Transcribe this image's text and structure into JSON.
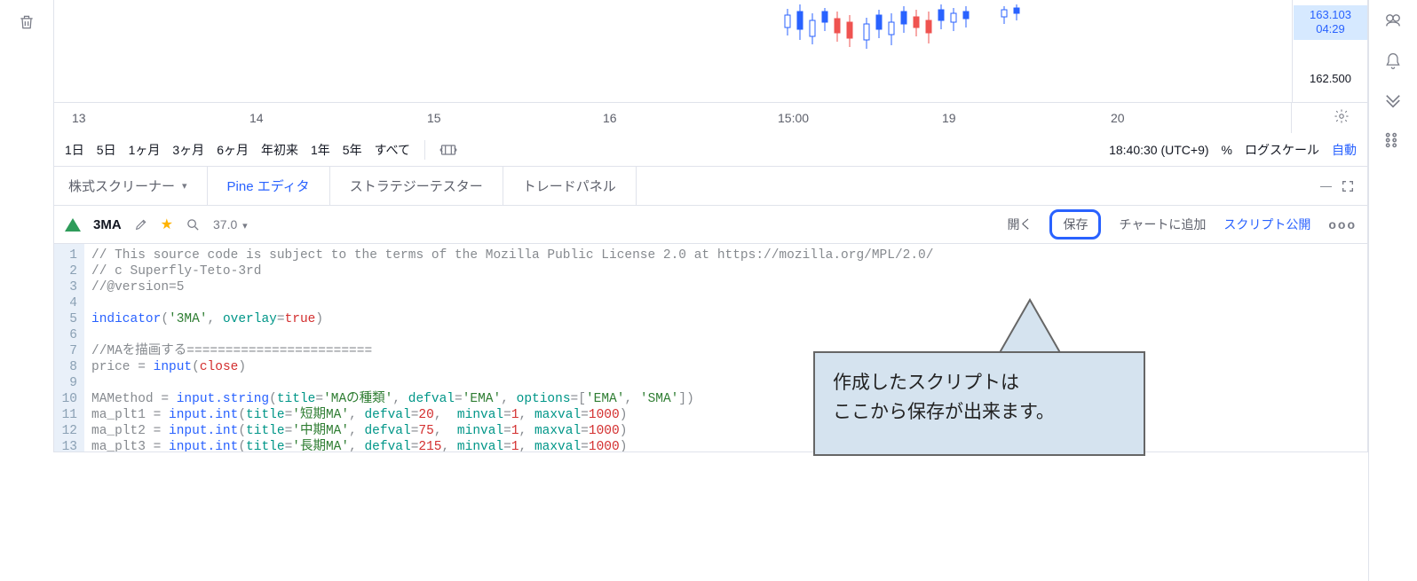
{
  "price": {
    "current": "163.103",
    "time": "04:29",
    "level": "162.500"
  },
  "xaxis_ticks": [
    "13",
    "14",
    "15",
    "16",
    "15:00",
    "19",
    "20"
  ],
  "timeframes": [
    "1日",
    "5日",
    "1ヶ月",
    "3ヶ月",
    "6ヶ月",
    "年初来",
    "1年",
    "5年",
    "すべて"
  ],
  "clock": "18:40:30 (UTC+9)",
  "percent": "%",
  "logscale": "ログスケール",
  "auto": "自動",
  "panel_tabs": {
    "screener": "株式スクリーナー",
    "pine": "Pine エディタ",
    "tester": "ストラテジーテスター",
    "panel": "トレードパネル"
  },
  "script": {
    "name": "3MA",
    "version": "37.0",
    "open": "開く",
    "save": "保存",
    "add": "チャートに追加",
    "publish": "スクリプト公開",
    "more": "ooo"
  },
  "code_lines": [
    {
      "n": 1,
      "html": "// This source code is subject to the terms of the Mozilla Public License 2.0 at https://mozilla.org/MPL/2.0/"
    },
    {
      "n": 2,
      "html": "// c Superfly-Teto-3rd"
    },
    {
      "n": 3,
      "html": "//@version=5"
    },
    {
      "n": 4,
      "html": ""
    },
    {
      "n": 5,
      "html": "<span class=\"kw-blue\">indicator</span>(<span class=\"str\">'3MA'</span>, <span class=\"kw-teal\">overlay</span>=<span class=\"kw-red\">true</span>)"
    },
    {
      "n": 6,
      "html": ""
    },
    {
      "n": 7,
      "html": "//MAを描画する========================"
    },
    {
      "n": 8,
      "html": "price = <span class=\"kw-blue\">input</span>(<span class=\"kw-red\">close</span>)"
    },
    {
      "n": 9,
      "html": ""
    },
    {
      "n": 10,
      "html": "MAMethod = <span class=\"kw-blue\">input.string</span>(<span class=\"kw-teal\">title</span>=<span class=\"str\">'MAの種類'</span>, <span class=\"kw-teal\">defval</span>=<span class=\"str\">'EMA'</span>, <span class=\"kw-teal\">options</span>=[<span class=\"str\">'EMA'</span>, <span class=\"str\">'SMA'</span>])"
    },
    {
      "n": 11,
      "html": "ma_plt1 = <span class=\"kw-blue\">input.int</span>(<span class=\"kw-teal\">title</span>=<span class=\"str\">'短期MA'</span>, <span class=\"kw-teal\">defval</span>=<span class=\"num\">20</span>,  <span class=\"kw-teal\">minval</span>=<span class=\"num\">1</span>, <span class=\"kw-teal\">maxval</span>=<span class=\"num\">1000</span>)"
    },
    {
      "n": 12,
      "html": "ma_plt2 = <span class=\"kw-blue\">input.int</span>(<span class=\"kw-teal\">title</span>=<span class=\"str\">'中期MA'</span>, <span class=\"kw-teal\">defval</span>=<span class=\"num\">75</span>,  <span class=\"kw-teal\">minval</span>=<span class=\"num\">1</span>, <span class=\"kw-teal\">maxval</span>=<span class=\"num\">1000</span>)"
    },
    {
      "n": 13,
      "html": "ma_plt3 = <span class=\"kw-blue\">input.int</span>(<span class=\"kw-teal\">title</span>=<span class=\"str\">'長期MA'</span>, <span class=\"kw-teal\">defval</span>=<span class=\"num\">215</span>, <span class=\"kw-teal\">minval</span>=<span class=\"num\">1</span>, <span class=\"kw-teal\">maxval</span>=<span class=\"num\">1000</span>)"
    }
  ],
  "callout": {
    "l1": "作成したスクリプトは",
    "l2": "ここから保存が出来ます。"
  },
  "chart_data": {
    "type": "candlestick",
    "note": "partial OHLC candles visible at top of chart; exact values not labeled per-bar",
    "visible_price_range": [
      162.5,
      163.1
    ],
    "current_price": 163.103,
    "time_label": "04:29",
    "x_ticks": [
      "13",
      "14",
      "15",
      "16",
      "15:00",
      "19",
      "20"
    ]
  }
}
